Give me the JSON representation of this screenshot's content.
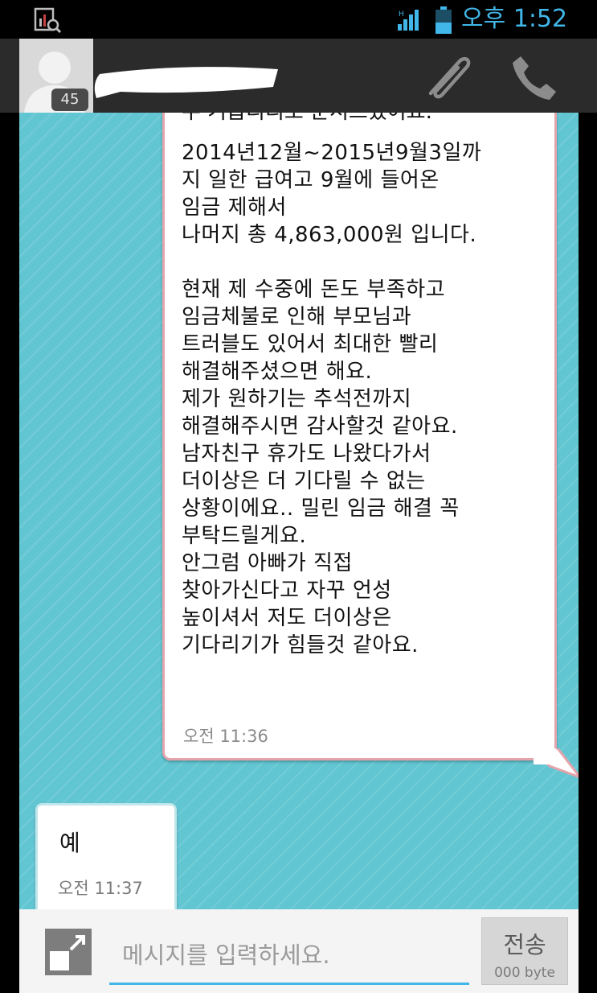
{
  "status_bar": {
    "time": "오후 1:52",
    "icons": [
      "chart-search-icon",
      "signal-icon",
      "battery-icon"
    ],
    "accent_color": "#41b6e8"
  },
  "header": {
    "avatar_badge": "45",
    "icons": [
      "avatar-icon",
      "paperclip-icon",
      "phone-icon"
    ]
  },
  "messages": {
    "incoming": {
      "cutoff_line": "주 기급리리로 순서드셨어요.",
      "text": "2014년12월~2015년9월3일까\n지 일한 급여고 9월에 들어온\n임금 제해서\n나머지 총 4,863,000원 입니다.\n\n현재 제 수중에 돈도 부족하고\n임금체불로 인해 부모님과\n트러블도 있어서 최대한 빨리\n해결해주셨으면 해요.\n제가 원하기는 추석전까지\n해결해주시면 감사할것 같아요.\n남자친구 휴가도 나왔다가서\n더이상은 더 기다릴 수 없는\n상황이에요.. 밀린 임금 해결 꼭\n부탁드릴게요.\n안그럼 아빠가 직접\n찾아가신다고 자꾸 언성\n높이셔서 저도 더이상은\n기다리기가 힘들것 같아요.",
      "time": "오전 11:36"
    },
    "outgoing": {
      "text": "예",
      "time": "오전 11:37"
    }
  },
  "input_bar": {
    "placeholder": "메시지를 입력하세요.",
    "send_label": "전송",
    "byte_count": "000 byte",
    "icons": [
      "expand-icon"
    ]
  },
  "colors": {
    "chat_background": "#62c6d2",
    "incoming_border": "#e3a4ac",
    "header_background": "#2b2b2b"
  }
}
